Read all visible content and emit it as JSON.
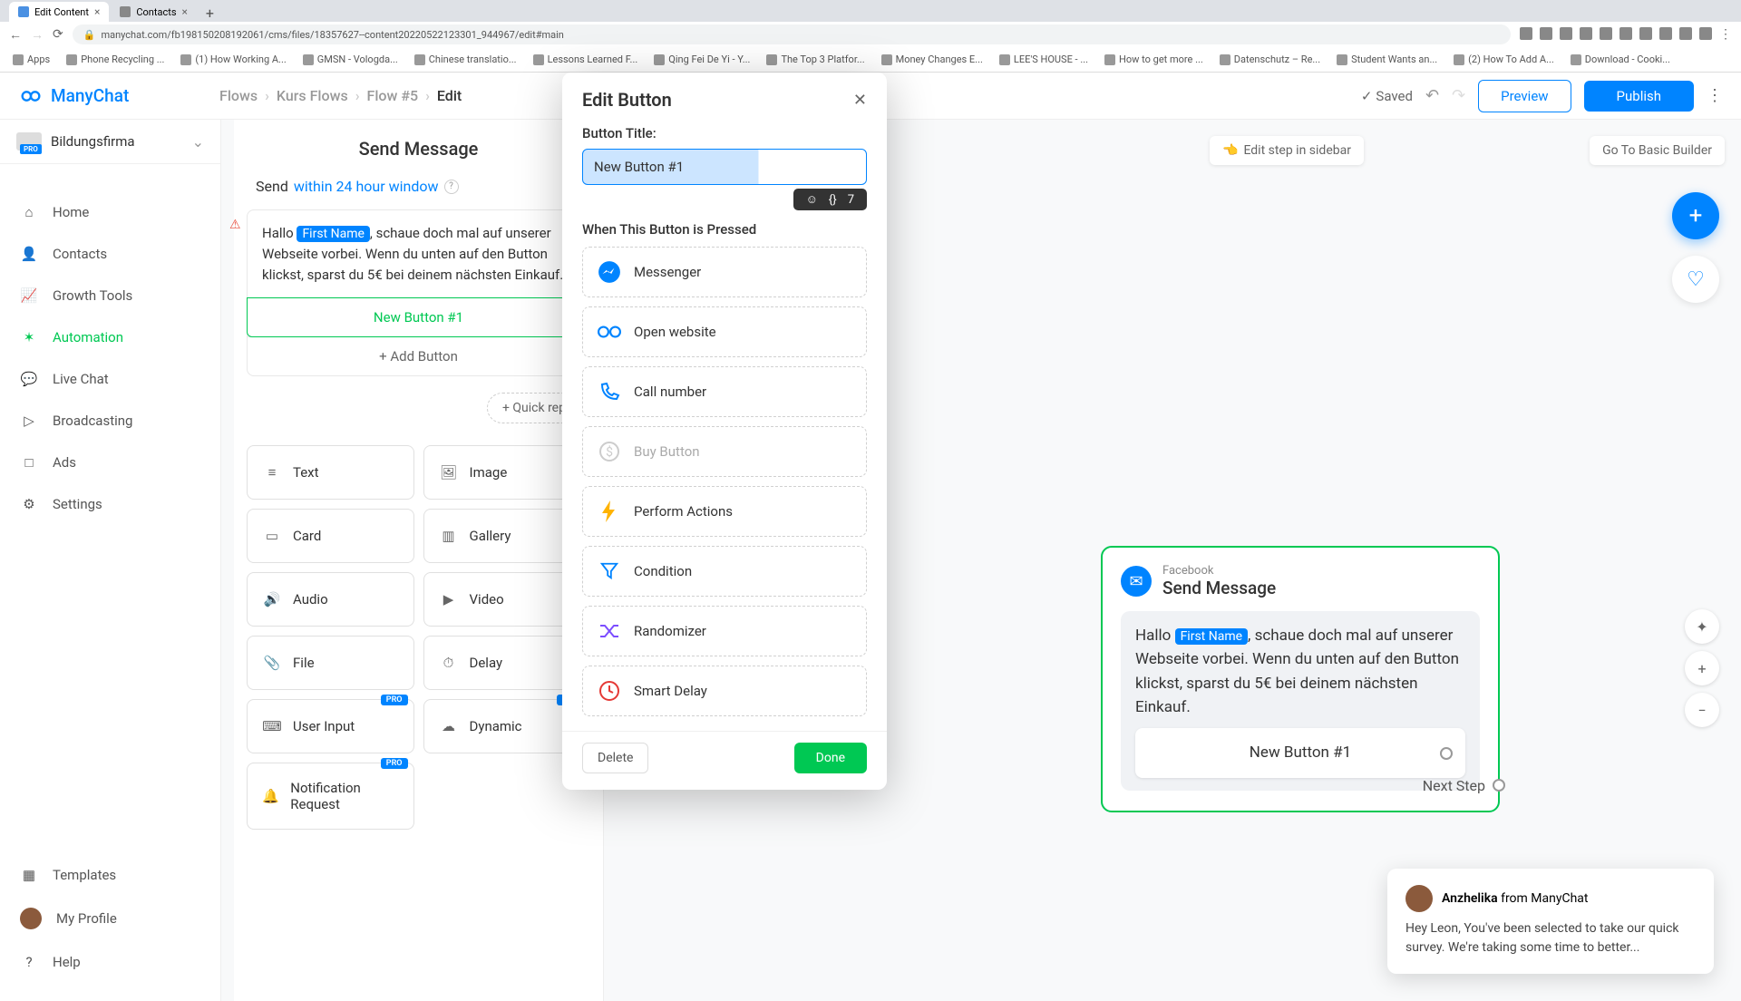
{
  "browser": {
    "tabs": [
      {
        "title": "Edit Content",
        "active": true
      },
      {
        "title": "Contacts",
        "active": false
      }
    ],
    "url": "manychat.com/fb198150208192061/cms/files/18357627--content20220522123301_944967/edit#main",
    "bookmarks": [
      "Apps",
      "Phone Recycling ...",
      "(1) How Working A...",
      "GMSN - Vologda...",
      "Chinese translatio...",
      "Lessons Learned F...",
      "Qing Fei De Yi - Y...",
      "The Top 3 Platfor...",
      "Money Changes E...",
      "LEE'S HOUSE - ...",
      "How to get more ...",
      "Datenschutz – Re...",
      "Student Wants an...",
      "(2) How To Add A...",
      "Download - Cooki..."
    ]
  },
  "brand": "ManyChat",
  "breadcrumbs": [
    "Flows",
    "Kurs Flows",
    "Flow #5",
    "Edit"
  ],
  "header": {
    "saved": "Saved",
    "preview": "Preview",
    "publish": "Publish"
  },
  "workspace": {
    "name": "Bildungsfirma",
    "badge": "PRO"
  },
  "nav": {
    "items": [
      "Home",
      "Contacts",
      "Growth Tools",
      "Automation",
      "Live Chat",
      "Broadcasting",
      "Ads",
      "Settings"
    ],
    "active_index": 3,
    "bottom": [
      "Templates",
      "My Profile",
      "Help"
    ]
  },
  "editor": {
    "title": "Send Message",
    "send_prefix": "Send",
    "send_window": "within 24 hour window",
    "message_prefix": "Hallo ",
    "message_tag": "First Name",
    "message_suffix": ", schaue doch mal auf unserer Webseite vorbei. Wenn du unten auf den Button klickst, sparst du 5€ bei deinem nächsten Einkauf.",
    "button_label": "New Button #1",
    "add_button": "+ Add Button",
    "quick_reply": "+ Quick reply",
    "blocks": [
      "Text",
      "Image",
      "Card",
      "Gallery",
      "Audio",
      "Video",
      "File",
      "Delay",
      "User Input",
      "Dynamic",
      "Notification Request"
    ],
    "pro_blocks": [
      "User Input",
      "Dynamic",
      "Notification Request"
    ]
  },
  "modal": {
    "title": "Edit Button",
    "field_label": "Button Title:",
    "input_value": "New Button #1",
    "char_count": "7",
    "section_label": "When This Button is Pressed",
    "actions": [
      "Messenger",
      "Open website",
      "Call number",
      "Buy Button",
      "Perform Actions",
      "Condition",
      "Randomizer",
      "Smart Delay"
    ],
    "disabled_action_index": 3,
    "delete": "Delete",
    "done": "Done"
  },
  "canvas": {
    "edit_sidebar": "Edit step in sidebar",
    "go_basic": "Go To Basic Builder",
    "node": {
      "platform": "Facebook",
      "title": "Send Message",
      "msg_prefix": "Hallo ",
      "msg_tag": "First Name",
      "msg_suffix": ", schaue doch mal auf unserer Webseite vorbei. Wenn du unten auf den Button klickst, sparst du 5€ bei deinem nächsten Einkauf.",
      "button": "New Button #1",
      "next_step": "Next Step"
    }
  },
  "chat": {
    "author_name": "Anzhelika",
    "author_from": " from ManyChat",
    "message": "Hey Leon,  You've been selected to take our quick survey. We're taking some time to better..."
  }
}
